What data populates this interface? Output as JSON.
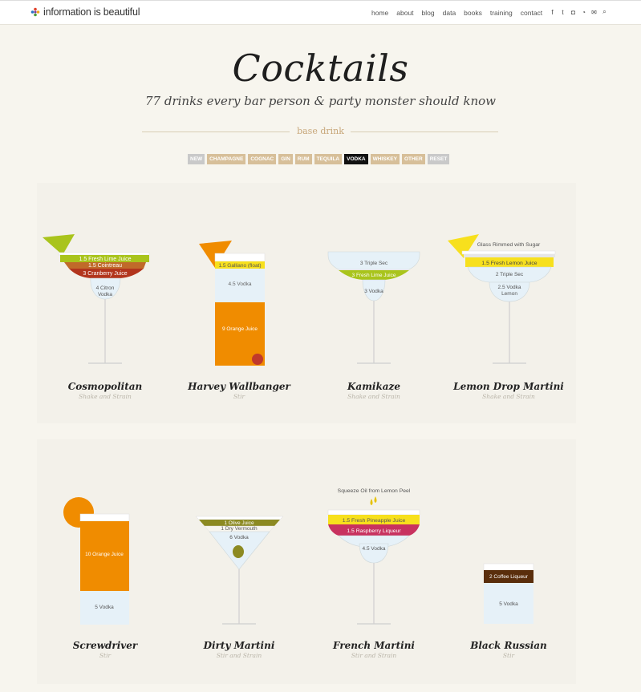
{
  "site": {
    "logo_text": "information is beautiful",
    "nav": [
      "home",
      "about",
      "blog",
      "data",
      "books",
      "training",
      "contact"
    ],
    "social_icons": [
      "facebook-icon",
      "twitter-icon",
      "instagram-icon",
      "rss-icon",
      "email-icon",
      "search-icon"
    ]
  },
  "page": {
    "title": "Cocktails",
    "subtitle": "77 drinks every bar person & party monster should know",
    "base_drink_label": "base drink"
  },
  "filters": [
    {
      "label": "NEW",
      "active": false
    },
    {
      "label": "CHAMPAGNE",
      "active": false
    },
    {
      "label": "COGNAC",
      "active": false
    },
    {
      "label": "GIN",
      "active": false
    },
    {
      "label": "RUM",
      "active": false
    },
    {
      "label": "TEQUILA",
      "active": false
    },
    {
      "label": "VODKA",
      "active": true
    },
    {
      "label": "WHISKEY",
      "active": false
    },
    {
      "label": "OTHER",
      "active": false
    },
    {
      "label": "RESET",
      "active": false
    }
  ],
  "colors": {
    "filter_tan": "#d7bf99",
    "filter_grey": "#c9c9c9",
    "filter_active": "#111111",
    "lime": "#a9c41c",
    "orange": "#f08c00",
    "cranberry": "#b2351d",
    "cointreau": "#c06a2a",
    "yellow": "#f7e01d",
    "raspberry": "#c8325f",
    "coffee": "#5a2e0c",
    "olive": "#8c8a22",
    "vodka": "#e6f1f8"
  },
  "drinks": [
    {
      "name": "Cosmopolitan",
      "method": "Shake and Strain",
      "ingredients": [
        "1.5 Fresh Lime Juice",
        "1.5 Cointreau",
        "3 Cranberry Juice",
        "4 Citron Vodka"
      ]
    },
    {
      "name": "Harvey Wallbanger",
      "method": "Stir",
      "ingredients": [
        "1.5 Galliano (float)",
        "4.5 Vodka",
        "9 Orange Juice"
      ]
    },
    {
      "name": "Kamikaze",
      "method": "Shake and Strain",
      "ingredients": [
        "3 Triple Sec",
        "3 Fresh Lime Juice",
        "3 Vodka"
      ]
    },
    {
      "name": "Lemon Drop Martini",
      "method": "Shake and Strain",
      "garnish": "Glass Rimmed with Sugar",
      "ingredients": [
        "1.5 Fresh Lemon Juice",
        "2 Triple Sec",
        "2.5 Vodka Lemon"
      ]
    },
    {
      "name": "Screwdriver",
      "method": "Stir",
      "ingredients": [
        "10 Orange Juice",
        "5 Vodka"
      ]
    },
    {
      "name": "Dirty Martini",
      "method": "Stir and Strain",
      "ingredients": [
        "1 Olive Juice",
        "1 Dry Vermouth",
        "6 Vodka"
      ]
    },
    {
      "name": "French Martini",
      "method": "Stir and Strain",
      "garnish": "Squeeze Oil from Lemon Peel",
      "ingredients": [
        "1.5 Fresh Pineapple Juice",
        "1.5 Raspberry Liqueur",
        "4.5 Vodka"
      ]
    },
    {
      "name": "Black Russian",
      "method": "Stir",
      "ingredients": [
        "2 Coffee Liqueur",
        "5 Vodka"
      ]
    }
  ]
}
